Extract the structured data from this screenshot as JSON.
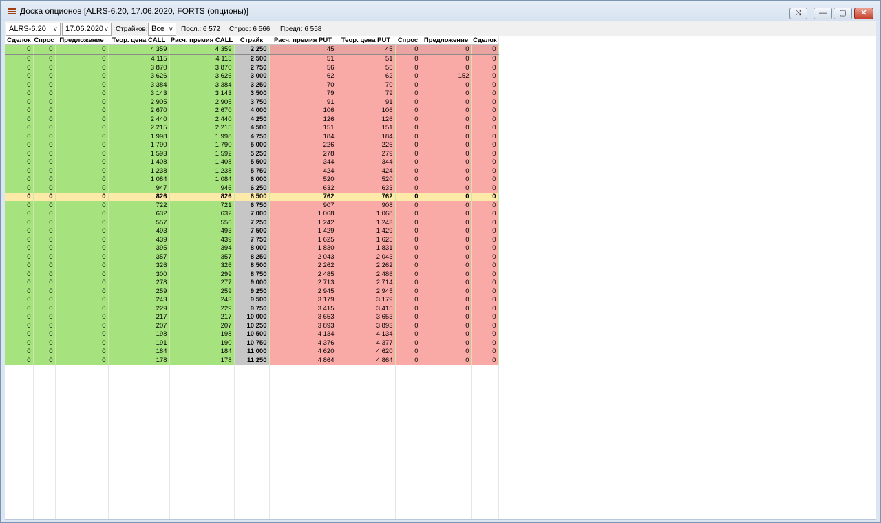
{
  "window": {
    "title": "Доска опционов [ALRS-6.20, 17.06.2020, FORTS (опционы)]",
    "buttons": {
      "pin": "⤨",
      "minimize": "—",
      "restore": "▢",
      "close": "✕"
    }
  },
  "toolbar": {
    "instrument": "ALRS-6.20",
    "date": "17.06.2020",
    "strikes_label": "Страйков:",
    "strikes_value": "Все",
    "last": "Посл.: 6 572",
    "bid": "Спрос: 6 566",
    "ask": "Предл: 6 558"
  },
  "headers": [
    "Сделок",
    "Спрос",
    "Предложение",
    "Теор. цена CALL",
    "Расч. премия CALL",
    "Страйк",
    "Расч. премия PUT",
    "Теор. цена PUT",
    "Спрос",
    "Предложение",
    "Сделок"
  ],
  "rows": [
    [
      "0",
      "0",
      "0",
      "4 359",
      "4 359",
      "2 250",
      "45",
      "45",
      "0",
      "0",
      "0"
    ],
    [
      "0",
      "0",
      "0",
      "4 115",
      "4 115",
      "2 500",
      "51",
      "51",
      "0",
      "0",
      "0"
    ],
    [
      "0",
      "0",
      "0",
      "3 870",
      "3 870",
      "2 750",
      "56",
      "56",
      "0",
      "0",
      "0"
    ],
    [
      "0",
      "0",
      "0",
      "3 626",
      "3 626",
      "3 000",
      "62",
      "62",
      "0",
      "152",
      "0"
    ],
    [
      "0",
      "0",
      "0",
      "3 384",
      "3 384",
      "3 250",
      "70",
      "70",
      "0",
      "0",
      "0"
    ],
    [
      "0",
      "0",
      "0",
      "3 143",
      "3 143",
      "3 500",
      "79",
      "79",
      "0",
      "0",
      "0"
    ],
    [
      "0",
      "0",
      "0",
      "2 905",
      "2 905",
      "3 750",
      "91",
      "91",
      "0",
      "0",
      "0"
    ],
    [
      "0",
      "0",
      "0",
      "2 670",
      "2 670",
      "4 000",
      "106",
      "106",
      "0",
      "0",
      "0"
    ],
    [
      "0",
      "0",
      "0",
      "2 440",
      "2 440",
      "4 250",
      "126",
      "126",
      "0",
      "0",
      "0"
    ],
    [
      "0",
      "0",
      "0",
      "2 215",
      "2 215",
      "4 500",
      "151",
      "151",
      "0",
      "0",
      "0"
    ],
    [
      "0",
      "0",
      "0",
      "1 998",
      "1 998",
      "4 750",
      "184",
      "184",
      "0",
      "0",
      "0"
    ],
    [
      "0",
      "0",
      "0",
      "1 790",
      "1 790",
      "5 000",
      "226",
      "226",
      "0",
      "0",
      "0"
    ],
    [
      "0",
      "0",
      "0",
      "1 593",
      "1 592",
      "5 250",
      "278",
      "279",
      "0",
      "0",
      "0"
    ],
    [
      "0",
      "0",
      "0",
      "1 408",
      "1 408",
      "5 500",
      "344",
      "344",
      "0",
      "0",
      "0"
    ],
    [
      "0",
      "0",
      "0",
      "1 238",
      "1 238",
      "5 750",
      "424",
      "424",
      "0",
      "0",
      "0"
    ],
    [
      "0",
      "0",
      "0",
      "1 084",
      "1 084",
      "6 000",
      "520",
      "520",
      "0",
      "0",
      "0"
    ],
    [
      "0",
      "0",
      "0",
      "947",
      "946",
      "6 250",
      "632",
      "633",
      "0",
      "0",
      "0"
    ],
    [
      "0",
      "0",
      "0",
      "826",
      "826",
      "6 500",
      "762",
      "762",
      "0",
      "0",
      "0"
    ],
    [
      "0",
      "0",
      "0",
      "722",
      "721",
      "6 750",
      "907",
      "908",
      "0",
      "0",
      "0"
    ],
    [
      "0",
      "0",
      "0",
      "632",
      "632",
      "7 000",
      "1 068",
      "1 068",
      "0",
      "0",
      "0"
    ],
    [
      "0",
      "0",
      "0",
      "557",
      "556",
      "7 250",
      "1 242",
      "1 243",
      "0",
      "0",
      "0"
    ],
    [
      "0",
      "0",
      "0",
      "493",
      "493",
      "7 500",
      "1 429",
      "1 429",
      "0",
      "0",
      "0"
    ],
    [
      "0",
      "0",
      "0",
      "439",
      "439",
      "7 750",
      "1 625",
      "1 625",
      "0",
      "0",
      "0"
    ],
    [
      "0",
      "0",
      "0",
      "395",
      "394",
      "8 000",
      "1 830",
      "1 831",
      "0",
      "0",
      "0"
    ],
    [
      "0",
      "0",
      "0",
      "357",
      "357",
      "8 250",
      "2 043",
      "2 043",
      "0",
      "0",
      "0"
    ],
    [
      "0",
      "0",
      "0",
      "326",
      "326",
      "8 500",
      "2 262",
      "2 262",
      "0",
      "0",
      "0"
    ],
    [
      "0",
      "0",
      "0",
      "300",
      "299",
      "8 750",
      "2 485",
      "2 486",
      "0",
      "0",
      "0"
    ],
    [
      "0",
      "0",
      "0",
      "278",
      "277",
      "9 000",
      "2 713",
      "2 714",
      "0",
      "0",
      "0"
    ],
    [
      "0",
      "0",
      "0",
      "259",
      "259",
      "9 250",
      "2 945",
      "2 945",
      "0",
      "0",
      "0"
    ],
    [
      "0",
      "0",
      "0",
      "243",
      "243",
      "9 500",
      "3 179",
      "3 179",
      "0",
      "0",
      "0"
    ],
    [
      "0",
      "0",
      "0",
      "229",
      "229",
      "9 750",
      "3 415",
      "3 415",
      "0",
      "0",
      "0"
    ],
    [
      "0",
      "0",
      "0",
      "217",
      "217",
      "10 000",
      "3 653",
      "3 653",
      "0",
      "0",
      "0"
    ],
    [
      "0",
      "0",
      "0",
      "207",
      "207",
      "10 250",
      "3 893",
      "3 893",
      "0",
      "0",
      "0"
    ],
    [
      "0",
      "0",
      "0",
      "198",
      "198",
      "10 500",
      "4 134",
      "4 134",
      "0",
      "0",
      "0"
    ],
    [
      "0",
      "0",
      "0",
      "191",
      "190",
      "10 750",
      "4 376",
      "4 377",
      "0",
      "0",
      "0"
    ],
    [
      "0",
      "0",
      "0",
      "184",
      "184",
      "11 000",
      "4 620",
      "4 620",
      "0",
      "0",
      "0"
    ],
    [
      "0",
      "0",
      "0",
      "178",
      "178",
      "11 250",
      "4 864",
      "4 864",
      "0",
      "0",
      "0"
    ]
  ],
  "highlight_strike": "6 500",
  "colors": {
    "call": "#a6e27e",
    "strike": "#c6c6c6",
    "put": "#f9a9a6",
    "highlight": "#fde9a8"
  }
}
